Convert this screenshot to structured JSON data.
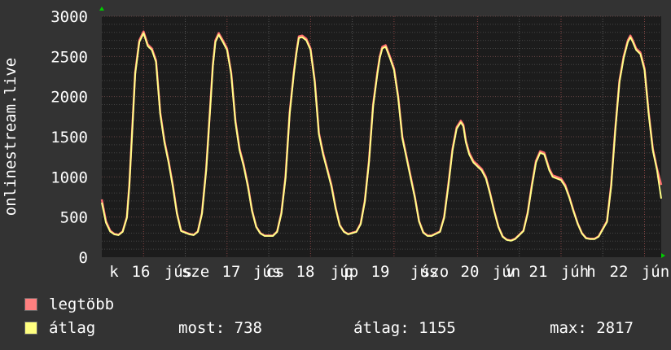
{
  "chart_data": {
    "type": "line",
    "ylabel": "onlinestream.live",
    "ylim": [
      0,
      3000
    ],
    "yticks": [
      0,
      500,
      1000,
      1500,
      2000,
      2500,
      3000
    ],
    "x_tick_labels": [
      "k",
      "16",
      "jús",
      "sze",
      "17",
      "jús",
      "cs",
      "18",
      "júp",
      "p",
      "19",
      "jús",
      "szo",
      "20",
      "jún",
      "v",
      "21",
      "júh",
      "h",
      "22",
      "jún"
    ],
    "grid": true,
    "series": [
      {
        "name": "legtöbb",
        "color": "#ff7070",
        "x": [
          0,
          0.05,
          0.1,
          0.15,
          0.2,
          0.25,
          0.3,
          0.33,
          0.36,
          0.4,
          0.45,
          0.5,
          0.55,
          0.6,
          0.65,
          0.7,
          0.75,
          0.8,
          0.85,
          0.9,
          0.95,
          1.05,
          1.1,
          1.15,
          1.2,
          1.25,
          1.3,
          1.33,
          1.36,
          1.4,
          1.45,
          1.5,
          1.55,
          1.6,
          1.65,
          1.7,
          1.75,
          1.8,
          1.85,
          1.9,
          1.95,
          2.05,
          2.1,
          2.15,
          2.2,
          2.25,
          2.3,
          2.33,
          2.36,
          2.4,
          2.45,
          2.5,
          2.55,
          2.6,
          2.65,
          2.7,
          2.75,
          2.8,
          2.85,
          2.9,
          2.95,
          3.05,
          3.1,
          3.15,
          3.2,
          3.25,
          3.3,
          3.33,
          3.36,
          3.4,
          3.45,
          3.5,
          3.55,
          3.6,
          3.65,
          3.7,
          3.75,
          3.8,
          3.85,
          3.9,
          3.95,
          4.05,
          4.1,
          4.15,
          4.2,
          4.25,
          4.3,
          4.33,
          4.36,
          4.4,
          4.45,
          4.5,
          4.55,
          4.6,
          4.65,
          4.7,
          4.75,
          4.8,
          4.85,
          4.9,
          4.95,
          5.05,
          5.1,
          5.15,
          5.2,
          5.25,
          5.3,
          5.33,
          5.36,
          5.4,
          5.45,
          5.5,
          5.55,
          5.6,
          5.65,
          5.7,
          5.75,
          5.8,
          5.85,
          5.9,
          5.95,
          6.05,
          6.1,
          6.15,
          6.2,
          6.25,
          6.3,
          6.33,
          6.36,
          6.4,
          6.45,
          6.5,
          6.55,
          6.6,
          6.65,
          6.7
        ],
        "values": [
          720,
          450,
          330,
          290,
          280,
          320,
          500,
          900,
          1500,
          2300,
          2700,
          2810,
          2650,
          2600,
          2450,
          1800,
          1450,
          1200,
          900,
          550,
          330,
          290,
          280,
          320,
          550,
          1100,
          1900,
          2400,
          2700,
          2790,
          2700,
          2600,
          2300,
          1700,
          1350,
          1150,
          900,
          580,
          380,
          300,
          270,
          270,
          320,
          550,
          1000,
          1800,
          2300,
          2550,
          2750,
          2760,
          2720,
          2600,
          2200,
          1550,
          1300,
          1100,
          900,
          620,
          400,
          320,
          290,
          320,
          420,
          700,
          1200,
          1900,
          2300,
          2500,
          2620,
          2640,
          2500,
          2350,
          2000,
          1500,
          1250,
          1000,
          750,
          450,
          310,
          270,
          270,
          320,
          500,
          900,
          1350,
          1620,
          1700,
          1650,
          1450,
          1300,
          1200,
          1150,
          1100,
          1000,
          800,
          580,
          380,
          260,
          220,
          210,
          230,
          330,
          550,
          900,
          1200,
          1320,
          1300,
          1200,
          1100,
          1020,
          1000,
          980,
          900,
          750,
          580,
          420,
          300,
          240,
          230,
          230,
          260,
          450,
          900,
          1600,
          2200,
          2500,
          2700,
          2760,
          2700,
          2600,
          2550,
          2350,
          1800,
          1350,
          1100,
          900
        ]
      },
      {
        "name": "átlag",
        "color": "#ffff88",
        "x": [
          0,
          0.05,
          0.1,
          0.15,
          0.2,
          0.25,
          0.3,
          0.33,
          0.36,
          0.4,
          0.45,
          0.5,
          0.55,
          0.6,
          0.65,
          0.7,
          0.75,
          0.8,
          0.85,
          0.9,
          0.95,
          1.05,
          1.1,
          1.15,
          1.2,
          1.25,
          1.3,
          1.33,
          1.36,
          1.4,
          1.45,
          1.5,
          1.55,
          1.6,
          1.65,
          1.7,
          1.75,
          1.8,
          1.85,
          1.9,
          1.95,
          2.05,
          2.1,
          2.15,
          2.2,
          2.25,
          2.3,
          2.33,
          2.36,
          2.4,
          2.45,
          2.5,
          2.55,
          2.6,
          2.65,
          2.7,
          2.75,
          2.8,
          2.85,
          2.9,
          2.95,
          3.05,
          3.1,
          3.15,
          3.2,
          3.25,
          3.3,
          3.33,
          3.36,
          3.4,
          3.45,
          3.5,
          3.55,
          3.6,
          3.65,
          3.7,
          3.75,
          3.8,
          3.85,
          3.9,
          3.95,
          4.05,
          4.1,
          4.15,
          4.2,
          4.25,
          4.3,
          4.33,
          4.36,
          4.4,
          4.45,
          4.5,
          4.55,
          4.6,
          4.65,
          4.7,
          4.75,
          4.8,
          4.85,
          4.9,
          4.95,
          5.05,
          5.1,
          5.15,
          5.2,
          5.25,
          5.3,
          5.33,
          5.36,
          5.4,
          5.45,
          5.5,
          5.55,
          5.6,
          5.65,
          5.7,
          5.75,
          5.8,
          5.85,
          5.9,
          5.95,
          6.05,
          6.1,
          6.15,
          6.2,
          6.25,
          6.3,
          6.33,
          6.36,
          6.4,
          6.45,
          6.5,
          6.55,
          6.6,
          6.65,
          6.7
        ],
        "values": [
          680,
          430,
          320,
          285,
          275,
          315,
          490,
          880,
          1480,
          2280,
          2680,
          2790,
          2630,
          2580,
          2430,
          1780,
          1430,
          1180,
          880,
          540,
          325,
          285,
          275,
          315,
          540,
          1080,
          1880,
          2380,
          2680,
          2770,
          2680,
          2580,
          2280,
          1680,
          1330,
          1130,
          880,
          570,
          375,
          295,
          265,
          265,
          315,
          540,
          980,
          1780,
          2280,
          2530,
          2730,
          2740,
          2700,
          2580,
          2180,
          1530,
          1280,
          1080,
          880,
          610,
          395,
          315,
          285,
          315,
          410,
          690,
          1180,
          1880,
          2280,
          2480,
          2600,
          2620,
          2480,
          2330,
          1980,
          1480,
          1230,
          980,
          740,
          445,
          305,
          265,
          265,
          315,
          490,
          880,
          1330,
          1600,
          1680,
          1630,
          1430,
          1280,
          1180,
          1130,
          1080,
          980,
          790,
          570,
          375,
          255,
          215,
          205,
          225,
          325,
          540,
          880,
          1180,
          1300,
          1280,
          1180,
          1080,
          1000,
          980,
          960,
          880,
          740,
          570,
          415,
          295,
          235,
          225,
          225,
          255,
          440,
          880,
          1580,
          2180,
          2480,
          2680,
          2740,
          2680,
          2580,
          2530,
          2330,
          1780,
          1330,
          1080,
          730
        ]
      }
    ]
  },
  "legend": [
    {
      "label": "legtöbb",
      "color": "#ff8080"
    },
    {
      "label": "átlag",
      "color": "#ffff80"
    }
  ],
  "stats": {
    "most": "most: 738",
    "atlag": "átlag: 1155",
    "max": "max: 2817"
  }
}
